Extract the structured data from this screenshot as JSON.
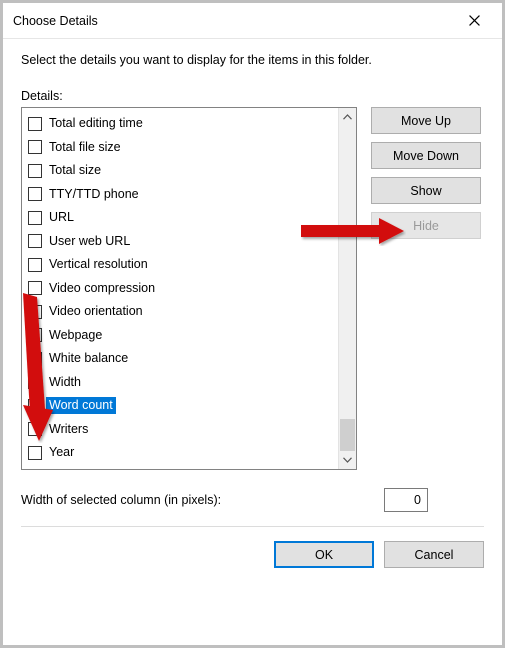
{
  "window": {
    "title": "Choose Details"
  },
  "instruction": "Select the details you want to display for the items in this folder.",
  "details_label": "Details:",
  "details_items": [
    {
      "label": "Total editing time",
      "checked": false,
      "selected": false
    },
    {
      "label": "Total file size",
      "checked": false,
      "selected": false
    },
    {
      "label": "Total size",
      "checked": false,
      "selected": false
    },
    {
      "label": "TTY/TTD phone",
      "checked": false,
      "selected": false
    },
    {
      "label": "URL",
      "checked": false,
      "selected": false
    },
    {
      "label": "User web URL",
      "checked": false,
      "selected": false
    },
    {
      "label": "Vertical resolution",
      "checked": false,
      "selected": false
    },
    {
      "label": "Video compression",
      "checked": false,
      "selected": false
    },
    {
      "label": "Video orientation",
      "checked": false,
      "selected": false
    },
    {
      "label": "Webpage",
      "checked": false,
      "selected": false
    },
    {
      "label": "White balance",
      "checked": false,
      "selected": false
    },
    {
      "label": "Width",
      "checked": false,
      "selected": false
    },
    {
      "label": "Word count",
      "checked": false,
      "selected": true
    },
    {
      "label": "Writers",
      "checked": false,
      "selected": false
    },
    {
      "label": "Year",
      "checked": false,
      "selected": false
    }
  ],
  "side_buttons": {
    "move_up": "Move Up",
    "move_down": "Move Down",
    "show": "Show",
    "hide": "Hide"
  },
  "width_label": "Width of selected column (in pixels):",
  "width_value": "0",
  "dialog_buttons": {
    "ok": "OK",
    "cancel": "Cancel"
  }
}
